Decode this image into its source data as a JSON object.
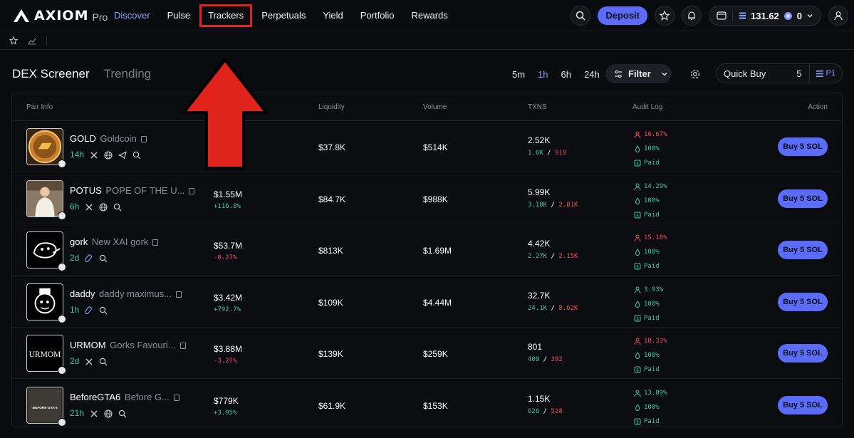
{
  "brand": {
    "name": "AXIOM",
    "sub": "Pro"
  },
  "nav": [
    {
      "label": "Discover",
      "state": "active"
    },
    {
      "label": "Pulse",
      "state": ""
    },
    {
      "label": "Trackers",
      "state": "highlight"
    },
    {
      "label": "Perpetuals",
      "state": ""
    },
    {
      "label": "Yield",
      "state": ""
    },
    {
      "label": "Portfolio",
      "state": ""
    },
    {
      "label": "Rewards",
      "state": ""
    }
  ],
  "header_actions": {
    "deposit_label": "Deposit",
    "balance": "131.62",
    "points": "0"
  },
  "section": {
    "tab_main": "DEX Screener",
    "tab_sub": "Trending"
  },
  "time_filters": [
    {
      "label": "5m",
      "active": false
    },
    {
      "label": "1h",
      "active": true
    },
    {
      "label": "6h",
      "active": false
    },
    {
      "label": "24h",
      "active": false
    }
  ],
  "filter_label": "Filter",
  "quick_buy": {
    "label": "Quick Buy",
    "value": "5",
    "preset": "P1"
  },
  "columns": {
    "pair_info": "Pair Info",
    "liquidity": "Liquidity",
    "volume": "Volume",
    "txns": "TXNS",
    "audit_log": "Audit Log",
    "action": "Action"
  },
  "colors": {
    "accent": "#5b6cf8",
    "positive": "#41c9a0",
    "negative": "#f04a63",
    "highlight": "#e0241b"
  },
  "rows": [
    {
      "ticker": "GOLD",
      "name": "Goldcoin",
      "age": "14h",
      "socials": [
        "x-icon",
        "globe-icon",
        "telegram-icon",
        "search-icon"
      ],
      "mcap": "",
      "mcap_change": "",
      "change_dir": "",
      "liquidity": "$37.8K",
      "volume": "$514K",
      "txns": "2.52K",
      "buys": "1.6K",
      "sells": "919",
      "audit_pct": "16.67%",
      "audit_dir": "neg",
      "audit_2": "100%",
      "audit_3": "Paid",
      "buy_label": "Buy 5 SOL",
      "thumb": "gold"
    },
    {
      "ticker": "POTUS",
      "name": "POPE OF THE U...",
      "age": "6h",
      "socials": [
        "x-icon",
        "globe-icon",
        "search-icon"
      ],
      "mcap": "$1.55M",
      "mcap_change": "+116.8%",
      "change_dir": "pos",
      "liquidity": "$84.7K",
      "volume": "$988K",
      "txns": "5.99K",
      "buys": "3.18K",
      "sells": "2.81K",
      "audit_pct": "14.29%",
      "audit_dir": "pos",
      "audit_2": "100%",
      "audit_3": "Paid",
      "buy_label": "Buy 5 SOL",
      "thumb": "potus"
    },
    {
      "ticker": "gork",
      "name": "New XAI gork",
      "age": "2d",
      "socials": [
        "pump-icon",
        "search-icon"
      ],
      "mcap": "$53.7M",
      "mcap_change": "-0.27%",
      "change_dir": "neg",
      "liquidity": "$813K",
      "volume": "$1.69M",
      "txns": "4.42K",
      "buys": "2.27K",
      "sells": "2.15K",
      "audit_pct": "15.18%",
      "audit_dir": "neg",
      "audit_2": "100%",
      "audit_3": "Paid",
      "buy_label": "Buy 5 SOL",
      "thumb": "gork"
    },
    {
      "ticker": "daddy",
      "name": "daddy maximus...",
      "age": "1h",
      "socials": [
        "pump-icon",
        "search-icon"
      ],
      "mcap": "$3.42M",
      "mcap_change": "+792.7%",
      "change_dir": "pos",
      "liquidity": "$109K",
      "volume": "$4.44M",
      "txns": "32.7K",
      "buys": "24.1K",
      "sells": "8.62K",
      "audit_pct": "3.93%",
      "audit_dir": "pos",
      "audit_2": "100%",
      "audit_3": "Paid",
      "buy_label": "Buy 5 SOL",
      "thumb": "daddy"
    },
    {
      "ticker": "URMOM",
      "name": "Gorks Favouri...",
      "age": "2d",
      "socials": [
        "x-icon",
        "search-icon"
      ],
      "mcap": "$3.88M",
      "mcap_change": "-3.27%",
      "change_dir": "neg",
      "liquidity": "$139K",
      "volume": "$259K",
      "txns": "801",
      "buys": "409",
      "sells": "392",
      "audit_pct": "18.33%",
      "audit_dir": "neg",
      "audit_2": "100%",
      "audit_3": "Paid",
      "buy_label": "Buy 5 SOL",
      "thumb": "urmom",
      "thumb_text": "URMOM"
    },
    {
      "ticker": "BeforeGTA6",
      "name": "Before G...",
      "age": "21h",
      "socials": [
        "x-icon",
        "globe-icon",
        "search-icon"
      ],
      "mcap": "$779K",
      "mcap_change": "+3.95%",
      "change_dir": "pos",
      "liquidity": "$61.9K",
      "volume": "$153K",
      "txns": "1.15K",
      "buys": "626",
      "sells": "528",
      "audit_pct": "13.09%",
      "audit_dir": "pos",
      "audit_2": "100%",
      "audit_3": "Paid",
      "buy_label": "Buy 5 SOL",
      "thumb": "gta",
      "thumb_text": "BEFORE GTA 6"
    }
  ]
}
